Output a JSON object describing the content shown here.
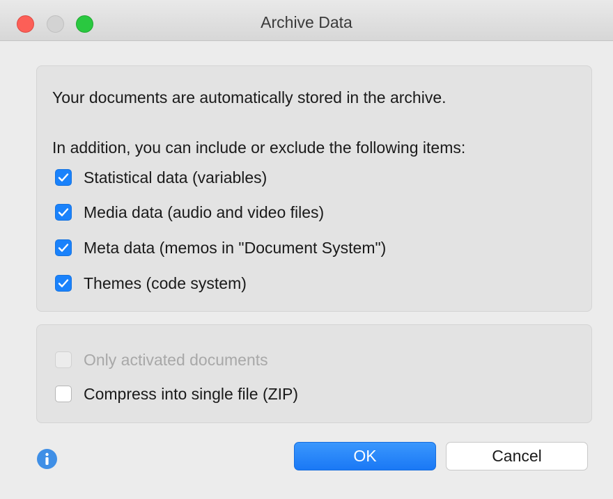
{
  "window": {
    "title": "Archive Data"
  },
  "content": {
    "intro_text": "Your documents are automatically stored in the archive.",
    "addition_text": "In addition, you can include or exclude the following items:",
    "include_items": [
      {
        "label": "Statistical data (variables)",
        "checked": true
      },
      {
        "label": "Media data (audio and video files)",
        "checked": true
      },
      {
        "label": "Meta data (memos in \"Document System\")",
        "checked": true
      },
      {
        "label": "Themes (code system)",
        "checked": true
      }
    ],
    "options": [
      {
        "label": "Only activated documents",
        "checked": false,
        "disabled": true
      },
      {
        "label": "Compress into single file (ZIP)",
        "checked": false,
        "disabled": false
      }
    ]
  },
  "buttons": {
    "ok_label": "OK",
    "cancel_label": "Cancel"
  },
  "colors": {
    "accent": "#1a82fb",
    "close": "#fc5f57",
    "zoom": "#2ac840",
    "info": "#3f8fe6"
  },
  "icons": {
    "info": "info-icon",
    "check": "checkmark-icon"
  }
}
